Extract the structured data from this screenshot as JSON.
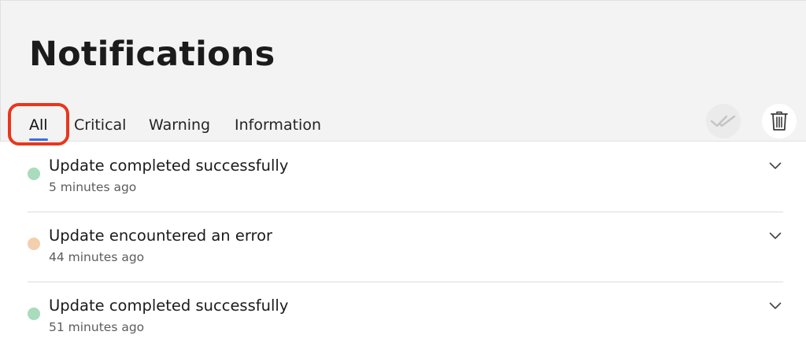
{
  "header": {
    "title": "Notifications"
  },
  "tabs": [
    {
      "label": "All",
      "active": true
    },
    {
      "label": "Critical",
      "active": false
    },
    {
      "label": "Warning",
      "active": false
    },
    {
      "label": "Information",
      "active": false
    }
  ],
  "actions": {
    "mark_all_read_icon": "double-check-icon",
    "delete_icon": "trash-icon"
  },
  "notifications": [
    {
      "title": "Update completed successfully",
      "time": "5 minutes ago",
      "status": "success",
      "dot_color": "#a8dcbc"
    },
    {
      "title": "Update encountered an error",
      "time": "44 minutes ago",
      "status": "error",
      "dot_color": "#f3cfae"
    },
    {
      "title": "Update completed successfully",
      "time": "51 minutes ago",
      "status": "success",
      "dot_color": "#a8dcbc"
    }
  ],
  "colors": {
    "accent": "#3a6fe0",
    "highlight": "#e8361c",
    "header_bg": "#f3f3f3"
  }
}
